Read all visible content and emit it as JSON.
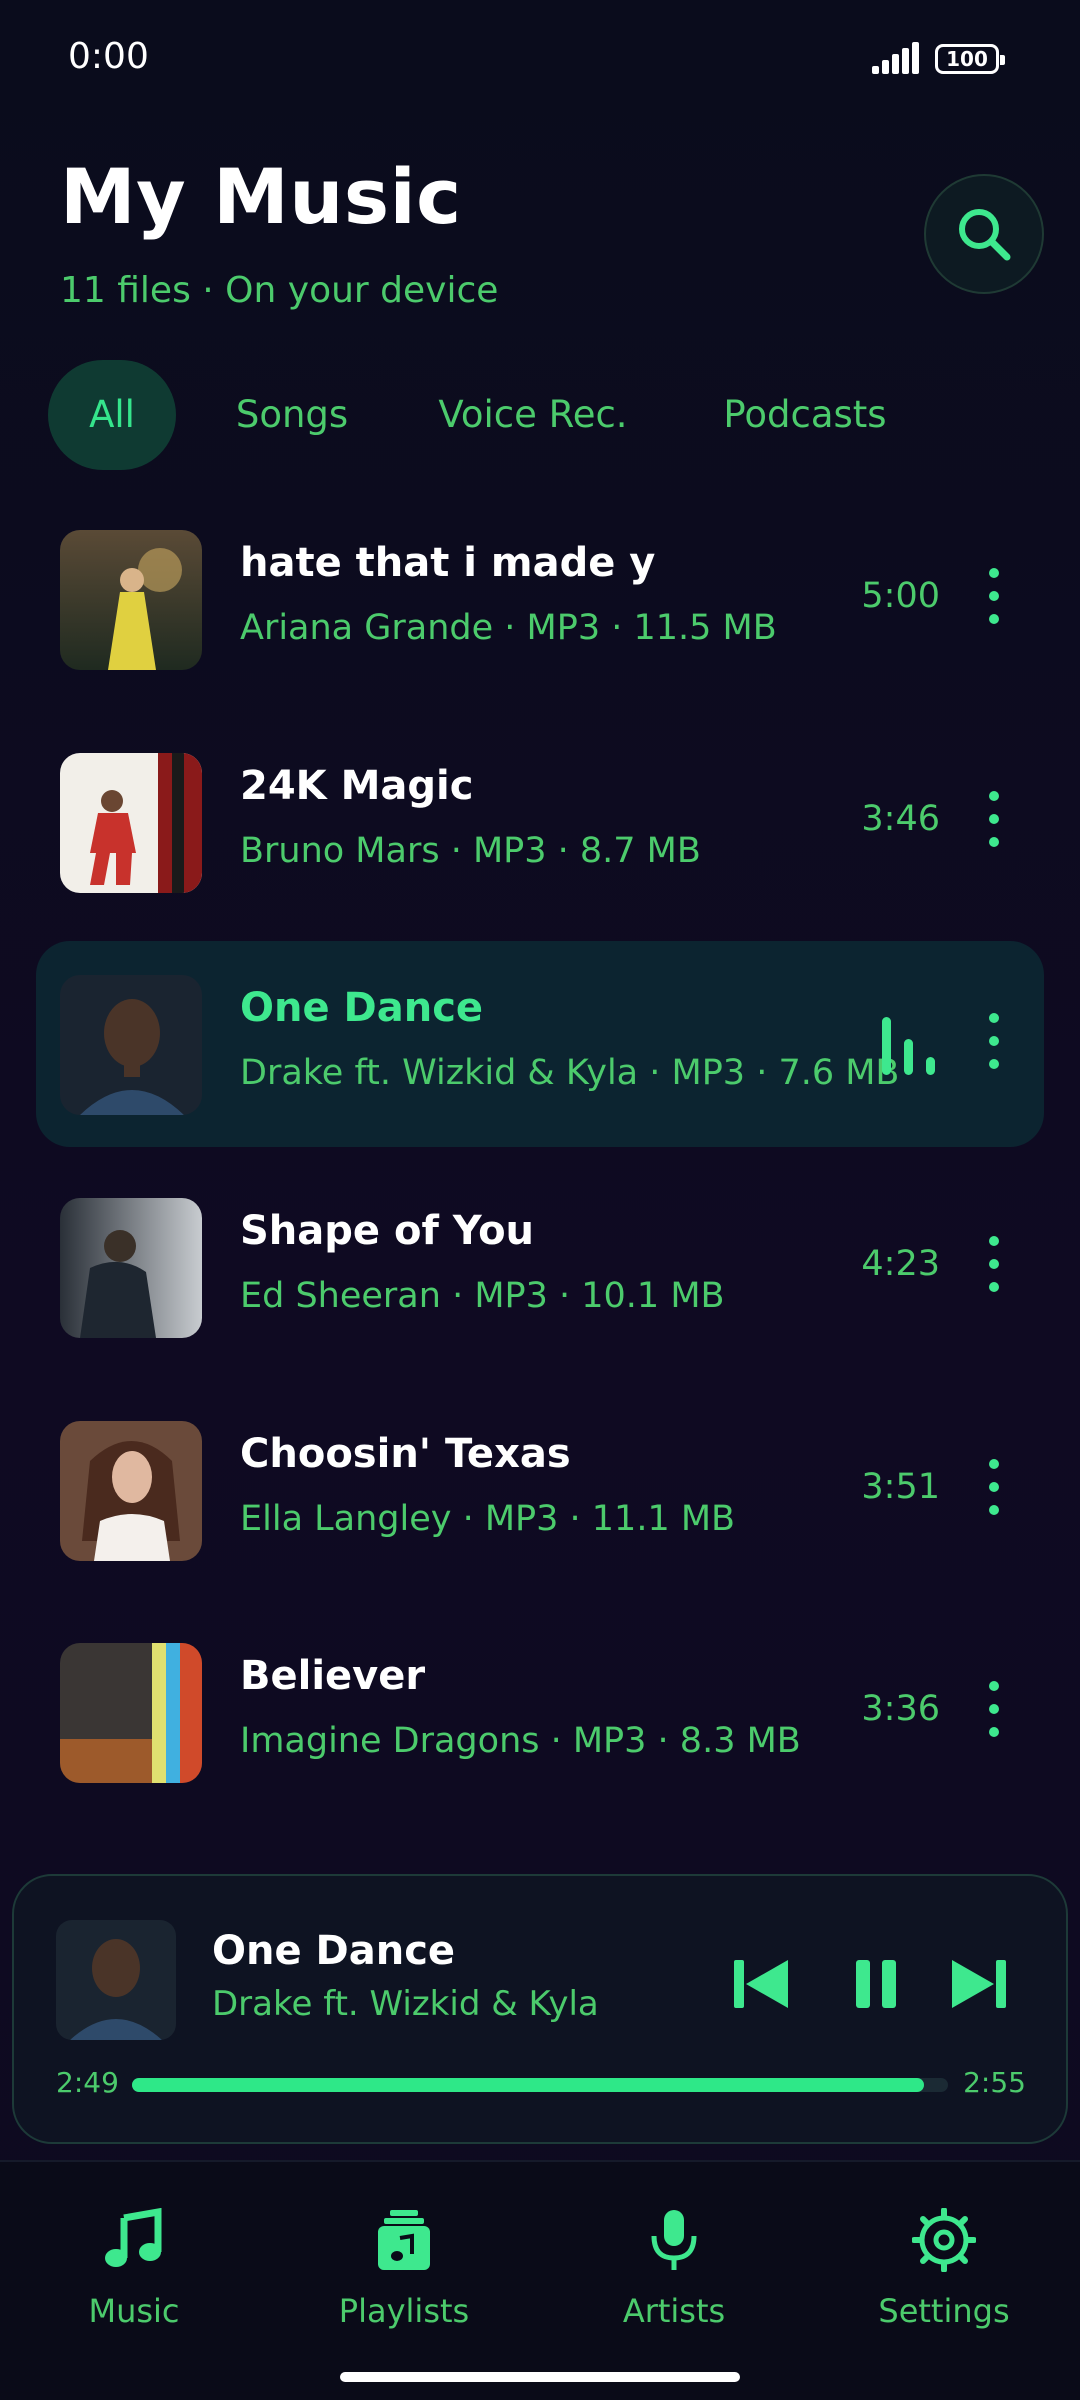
{
  "status_bar": {
    "time": "0:00",
    "battery": "100"
  },
  "header": {
    "title": "My Music",
    "subtitle": "11 files · On your device"
  },
  "tabs": [
    {
      "label": "All",
      "active": true
    },
    {
      "label": "Songs",
      "active": false
    },
    {
      "label": "Voice Rec.",
      "active": false
    },
    {
      "label": "Podcasts",
      "active": false
    }
  ],
  "tracks": [
    {
      "title": "hate that i made y",
      "meta": "Ariana Grande · MP3 · 11.5 MB",
      "duration": "5:00",
      "playing": false
    },
    {
      "title": "24K Magic",
      "meta": "Bruno Mars · MP3 · 8.7 MB",
      "duration": "3:46",
      "playing": false
    },
    {
      "title": "One Dance",
      "meta": "Drake ft. Wizkid & Kyla · MP3 · 7.6 MB",
      "duration": "",
      "playing": true
    },
    {
      "title": "Shape of You",
      "meta": "Ed Sheeran · MP3 · 10.1 MB",
      "duration": "4:23",
      "playing": false
    },
    {
      "title": "Choosin' Texas",
      "meta": "Ella Langley · MP3 · 11.1 MB",
      "duration": "3:51",
      "playing": false
    },
    {
      "title": "Believer",
      "meta": "Imagine Dragons · MP3 · 8.3 MB",
      "duration": "3:36",
      "playing": false
    }
  ],
  "now_playing": {
    "title": "One Dance",
    "artist": "Drake ft. Wizkid & Kyla",
    "current_time": "2:49",
    "total_time": "2:55",
    "progress": 0.97
  },
  "nav": [
    {
      "label": "Music",
      "icon": "music-note-icon",
      "active": true
    },
    {
      "label": "Playlists",
      "icon": "playlist-icon",
      "active": false
    },
    {
      "label": "Artists",
      "icon": "microphone-icon",
      "active": false
    },
    {
      "label": "Settings",
      "icon": "gear-icon",
      "active": false
    }
  ],
  "colors": {
    "accent": "#3ee88e",
    "secondary_text": "#4ccb6c",
    "background": "#0c0a1c",
    "active_row": "#0c2430"
  }
}
